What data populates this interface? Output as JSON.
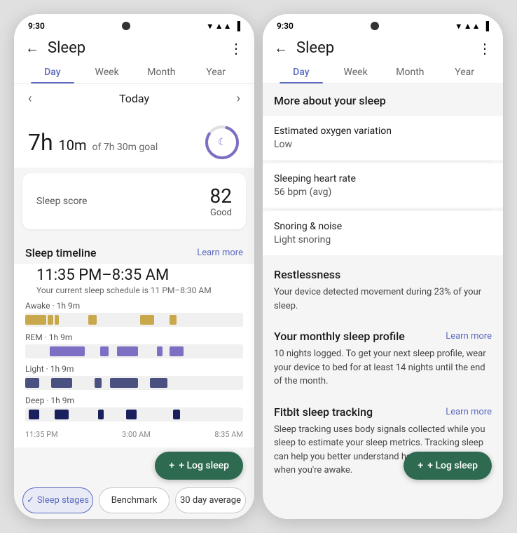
{
  "statusBar": {
    "time": "9:30"
  },
  "phone1": {
    "header": {
      "title": "Sleep",
      "backLabel": "←",
      "moreLabel": "⋮"
    },
    "tabs": [
      "Day",
      "Week",
      "Month",
      "Year"
    ],
    "activeTab": "Day",
    "dateNav": {
      "prev": "‹",
      "label": "Today",
      "next": "›"
    },
    "sleepSummary": {
      "hours": "7h",
      "minutes": "10m",
      "goal": "of 7h 30m goal"
    },
    "sleepScore": {
      "label": "Sleep score",
      "value": "82",
      "desc": "Good"
    },
    "timeline": {
      "sectionTitle": "Sleep timeline",
      "learnMore": "Learn more",
      "timeRange": "11:35 PM–8:35 AM",
      "scheduleNote": "Your current sleep schedule is 11 PM–8:30 AM",
      "stages": [
        {
          "label": "Awake · 1h 9m",
          "type": "awake"
        },
        {
          "label": "REM · 1h 9m",
          "type": "rem"
        },
        {
          "label": "Light · 1h 9m",
          "type": "light"
        },
        {
          "label": "Deep · 1h 9m",
          "type": "deep"
        }
      ],
      "xAxis": [
        "11:35 PM",
        "3:00 AM",
        "8:35 AM"
      ]
    },
    "bottomControls": [
      {
        "label": "Sleep stages",
        "active": true,
        "checkmark": "✓"
      },
      {
        "label": "Benchmark",
        "active": false
      },
      {
        "label": "30 day average",
        "active": false
      }
    ],
    "logSleepBtn": "+ Log sleep"
  },
  "phone2": {
    "header": {
      "title": "Sleep",
      "backLabel": "←",
      "moreLabel": "⋮"
    },
    "tabs": [
      "Day",
      "Week",
      "Month",
      "Year"
    ],
    "activeTab": "Day",
    "moreSleepTitle": "More about your sleep",
    "metrics": [
      {
        "name": "Estimated oxygen variation",
        "value": "Low"
      },
      {
        "name": "Sleeping heart rate",
        "value": "56 bpm (avg)"
      },
      {
        "name": "Snoring & noise",
        "value": "Light snoring"
      }
    ],
    "restlessness": {
      "title": "Restlessness",
      "desc": "Your device detected movement during 23% of your sleep."
    },
    "monthlyProfile": {
      "title": "Your monthly sleep profile",
      "learnMore": "Learn more",
      "desc": "10 nights logged. To get your next sleep profile, wear your device to bed for at least 14 nights until the end of the month."
    },
    "fitbitTracking": {
      "title": "Fitbit sleep tracking",
      "learnMore": "Learn more",
      "desc": "Sleep tracking uses body signals collected while you sleep to estimate your sleep metrics. Tracking sleep can help you better understand how well you feel when you're awake."
    },
    "logSleepBtn": "+ Log sleep"
  }
}
